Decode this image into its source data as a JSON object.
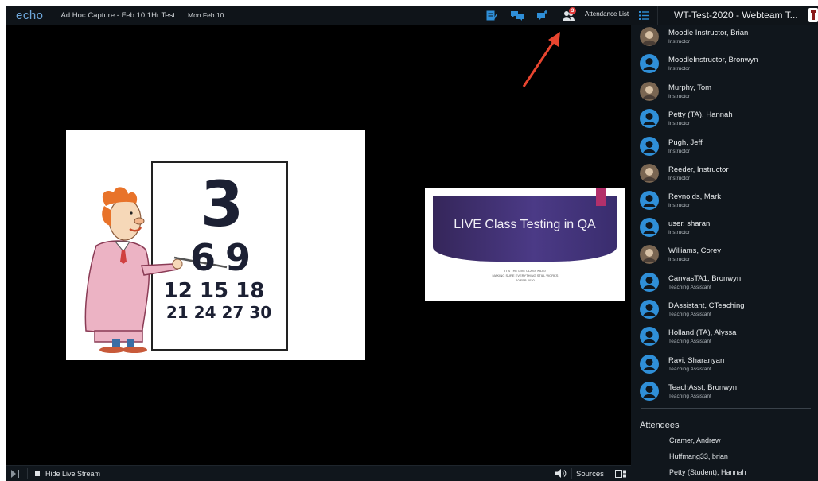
{
  "topbar": {
    "logo": "echo",
    "capture_title": "Ad Hoc Capture - Feb 10 1Hr Test",
    "capture_date": "Mon Feb 10",
    "attendee_badge": "3",
    "attendance_list_label": "Attendance List"
  },
  "sidebar": {
    "course_title": "WT-Test-2020 - Webteam T...",
    "instructors": [
      {
        "name": "Moodle Instructor, Brian",
        "role": "Instructor",
        "avatar": "photo"
      },
      {
        "name": "MoodleInstructor, Bronwyn",
        "role": "Instructor",
        "avatar": "default"
      },
      {
        "name": "Murphy, Tom",
        "role": "Instructor",
        "avatar": "photo"
      },
      {
        "name": "Petty (TA), Hannah",
        "role": "Instructor",
        "avatar": "default"
      },
      {
        "name": "Pugh, Jeff",
        "role": "Instructor",
        "avatar": "default"
      },
      {
        "name": "Reeder, Instructor",
        "role": "Instructor",
        "avatar": "photo"
      },
      {
        "name": "Reynolds, Mark",
        "role": "Instructor",
        "avatar": "default"
      },
      {
        "name": "user, sharan",
        "role": "Instructor",
        "avatar": "default"
      },
      {
        "name": "Williams, Corey",
        "role": "Instructor",
        "avatar": "photo"
      },
      {
        "name": "CanvasTA1, Bronwyn",
        "role": "Teaching Assistant",
        "avatar": "default"
      },
      {
        "name": "DAssistant, CTeaching",
        "role": "Teaching Assistant",
        "avatar": "default"
      },
      {
        "name": "Holland (TA), Alyssa",
        "role": "Teaching Assistant",
        "avatar": "default"
      },
      {
        "name": "Ravi, Sharanyan",
        "role": "Teaching Assistant",
        "avatar": "default"
      },
      {
        "name": "TeachAsst, Bronwyn",
        "role": "Teaching Assistant",
        "avatar": "default"
      }
    ],
    "attendees_heading": "Attendees",
    "attendees": [
      "Cramer, Andrew",
      "Huffmang33, brian",
      "Petty (Student), Hannah"
    ]
  },
  "cartoon": {
    "numbers": [
      "3",
      "6",
      "9",
      "12 15 18",
      "21 24 27 30"
    ]
  },
  "slide": {
    "title": "LIVE Class Testing in QA",
    "subtitle_lines": [
      "IT'S THE LIVE CLASS KIDS!",
      "MAKING SURE EVERYTHING STILL WORKS",
      "10 FEB 2020"
    ]
  },
  "bottombar": {
    "hide_label": "Hide Live Stream",
    "sources_label": "Sources"
  },
  "colors": {
    "accent_blue": "#2f8fd8",
    "badge_red": "#e03a3a",
    "arrow_red": "#e8452f",
    "slide_purple": "#4b3a86",
    "slide_tab": "#b3306b"
  }
}
